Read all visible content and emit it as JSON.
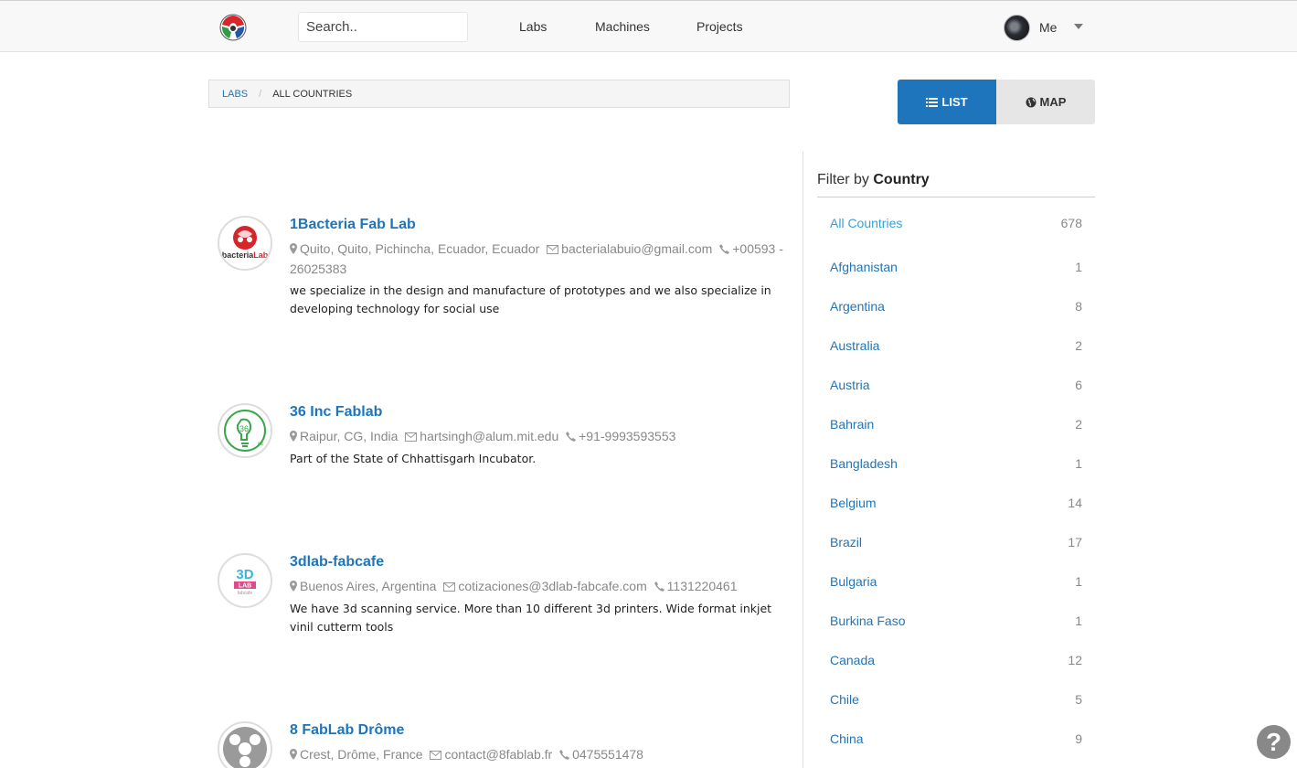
{
  "nav": {
    "search_placeholder": "Search..",
    "links": [
      "Labs",
      "Machines",
      "Projects"
    ],
    "user": "Me"
  },
  "breadcrumb": {
    "root": "LABS",
    "separator": "/",
    "current": "ALL COUNTRIES"
  },
  "view_toggle": {
    "list": "LIST",
    "map": "MAP"
  },
  "labs": [
    {
      "name": "1Bacteria Fab Lab",
      "location": "Quito, Quito, Pichincha, Ecuador, Ecuador",
      "email": "bacterialabuio@gmail.com",
      "phone": "+00593 - 26025383",
      "description": "we specialize in the design and manufacture of prototypes and we also specialize in developing technology for social use",
      "logo_icon": "bacterialab-logo"
    },
    {
      "name": "36 Inc Fablab",
      "location": "Raipur, CG, India",
      "email": "hartsingh@alum.mit.edu",
      "phone": "+91-9993593553",
      "description": "Part of the State of Chhattisgarh Incubator.",
      "logo_icon": "36inc-logo"
    },
    {
      "name": "3dlab-fabcafe",
      "location": "Buenos Aires, Argentina",
      "email": "cotizaciones@3dlab-fabcafe.com",
      "phone": "1131220461",
      "description": "We have 3d scanning service. More than 10 different 3d printers. Wide format inkjet vinil cutterm tools",
      "logo_icon": "3dlab-logo"
    },
    {
      "name": "8 FabLab Drôme",
      "location": "Crest, Drôme, France",
      "email": "contact@8fablab.fr",
      "phone": "0475551478",
      "description": "",
      "logo_icon": "fablab-default-logo"
    }
  ],
  "filter": {
    "title_prefix": "Filter by",
    "title_strong": "Country",
    "all": {
      "name": "All Countries",
      "count": "678"
    },
    "countries": [
      {
        "name": "Afghanistan",
        "count": "1"
      },
      {
        "name": "Argentina",
        "count": "8"
      },
      {
        "name": "Australia",
        "count": "2"
      },
      {
        "name": "Austria",
        "count": "6"
      },
      {
        "name": "Bahrain",
        "count": "2"
      },
      {
        "name": "Bangladesh",
        "count": "1"
      },
      {
        "name": "Belgium",
        "count": "14"
      },
      {
        "name": "Brazil",
        "count": "17"
      },
      {
        "name": "Bulgaria",
        "count": "1"
      },
      {
        "name": "Burkina Faso",
        "count": "1"
      },
      {
        "name": "Canada",
        "count": "12"
      },
      {
        "name": "Chile",
        "count": "5"
      },
      {
        "name": "China",
        "count": "9"
      }
    ]
  },
  "help_label": "?",
  "colors": {
    "accent": "#1f75b8",
    "toggle_active": "#1f75bb",
    "muted": "#888888"
  }
}
